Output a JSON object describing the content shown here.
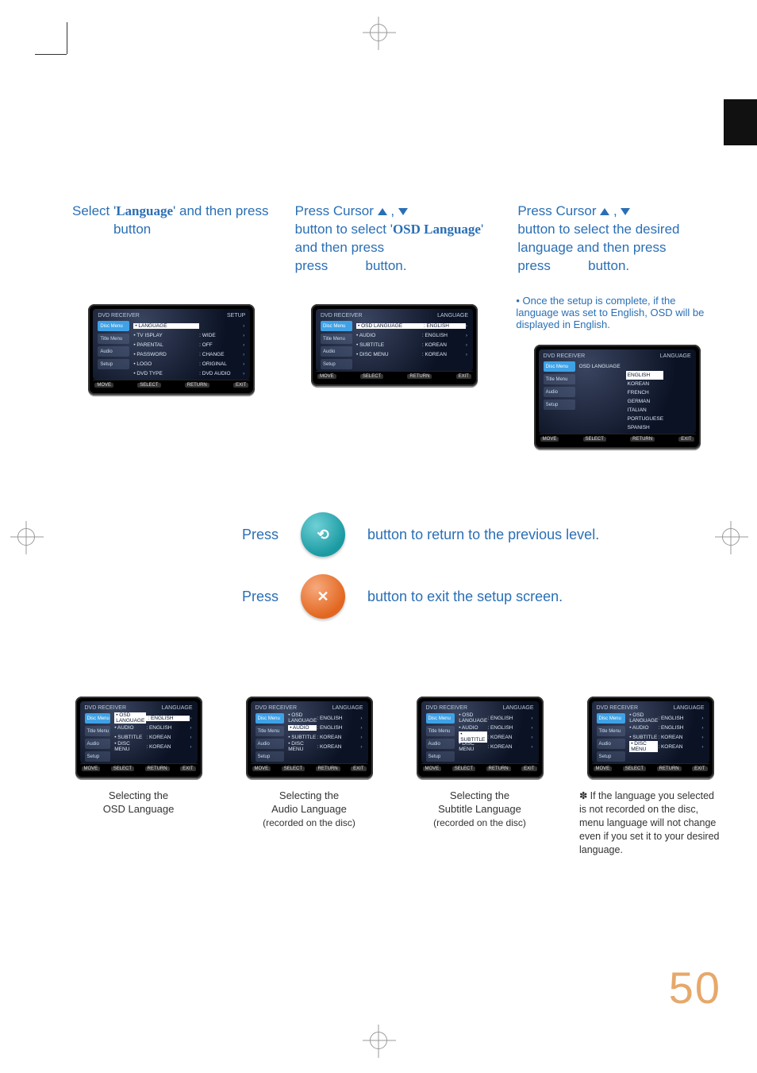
{
  "page_number": "50",
  "black_tab": true,
  "steps": {
    "step1": {
      "prefix": "Select '",
      "bold": "Language",
      "suffix": "' and then press",
      "after_icon": "button"
    },
    "step2": {
      "prefix": "Press Cursor ",
      "line2a": "button to select '",
      "bold": "OSD Language",
      "line2b": "' and then press",
      "after_icon": "button."
    },
    "step3": {
      "prefix": "Press Cursor ",
      "line2": "button to select the desired language and then press",
      "after_icon": "button."
    },
    "note_box": "• Once the setup is complete, if the language was set to English, OSD will be displayed in English."
  },
  "osd_common": {
    "left_title": "DVD RECEIVER",
    "sides": [
      "Disc Menu",
      "Title Menu",
      "Audio",
      "Setup"
    ],
    "foot": [
      "MOVE",
      "SELECT",
      "RETURN",
      "EXIT"
    ]
  },
  "osd1": {
    "right_title": "SETUP",
    "rows": [
      {
        "lab": "LANGUAGE",
        "val": "",
        "hi": "hi-lab"
      },
      {
        "lab": "TV   ISPLAY",
        "val": ": WIDE"
      },
      {
        "lab": "PARENTAL",
        "val": ": OFF"
      },
      {
        "lab": "PASSWORD",
        "val": ": CHANGE"
      },
      {
        "lab": "LOGO",
        "val": ": ORIGINAL"
      },
      {
        "lab": "DVD TYPE",
        "val": ": DVD AUDIO"
      }
    ]
  },
  "osd2": {
    "right_title": "LANGUAGE",
    "rows": [
      {
        "lab": "OSD LANGUAGE",
        "val": ": ENGLISH",
        "hi": "hi"
      },
      {
        "lab": "AUDIO",
        "val": ": ENGLISH"
      },
      {
        "lab": "SUBTITLE",
        "val": ": KOREAN"
      },
      {
        "lab": "DISC MENU",
        "val": ": KOREAN"
      }
    ]
  },
  "osd3": {
    "right_title": "LANGUAGE",
    "label": "OSD LANGUAGE",
    "options": [
      "ENGLISH",
      "KOREAN",
      "FRENCH",
      "GERMAN",
      "ITALIAN",
      "PORTUGUESE",
      "SPANISH"
    ],
    "selected": "ENGLISH"
  },
  "middle": {
    "row1_press": "Press",
    "row1_rest": "button to return to the previous level.",
    "row2_press": "Press",
    "row2_rest": "button to exit the setup screen."
  },
  "thumb_titles": {
    "right_title": "LANGUAGE"
  },
  "thumb1": {
    "caption1": "Selecting the",
    "caption2": "OSD Language",
    "rows": [
      {
        "lab": "OSD LANGUAGE",
        "val": ": ENGLISH",
        "hi": "hi"
      },
      {
        "lab": "AUDIO",
        "val": ": ENGLISH"
      },
      {
        "lab": "SUBTITLE",
        "val": ": KOREAN"
      },
      {
        "lab": "DISC MENU",
        "val": ": KOREAN"
      }
    ]
  },
  "thumb2": {
    "caption1": "Selecting the",
    "caption2": "Audio Language",
    "caption3": "(recorded on the disc)",
    "rows": [
      {
        "lab": "OSD LANGUAGE",
        "val": ": ENGLISH"
      },
      {
        "lab": "AUDIO",
        "val": ": ENGLISH",
        "hi": "hi-lab"
      },
      {
        "lab": "SUBTITLE",
        "val": ": KOREAN"
      },
      {
        "lab": "DISC MENU",
        "val": ": KOREAN"
      }
    ]
  },
  "thumb3": {
    "caption1": "Selecting the",
    "caption2": "Subtitle Language",
    "caption3": "(recorded on the disc)",
    "rows": [
      {
        "lab": "OSD LANGUAGE",
        "val": ": ENGLISH"
      },
      {
        "lab": "AUDIO",
        "val": ": ENGLISH"
      },
      {
        "lab": "SUBTITLE",
        "val": ": KOREAN",
        "hi": "hi-lab"
      },
      {
        "lab": "DISC MENU",
        "val": ": KOREAN"
      }
    ]
  },
  "thumb4": {
    "rows": [
      {
        "lab": "OSD LANGUAGE",
        "val": ": ENGLISH"
      },
      {
        "lab": "AUDIO",
        "val": ": ENGLISH"
      },
      {
        "lab": "SUBTITLE",
        "val": ": KOREAN"
      },
      {
        "lab": "DISC MENU",
        "val": ": KOREAN",
        "hi": "hi-lab"
      }
    ]
  },
  "footnote": "If the language you selected is not recorded on the disc, menu language will not change even if you set it to your desired language."
}
